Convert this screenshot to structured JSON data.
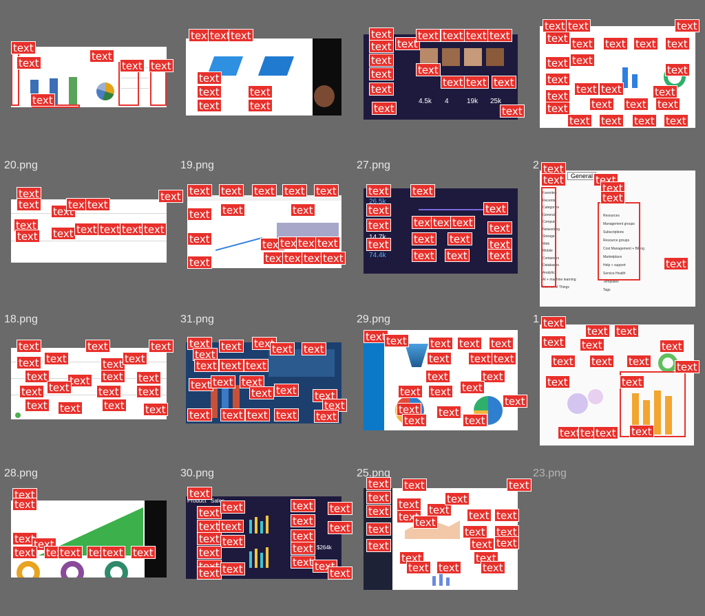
{
  "grid": {
    "background": "#6a6a6a",
    "tag_color": "#e8302b",
    "tag_text": "text"
  },
  "cells": [
    {
      "id": "c1",
      "label": ""
    },
    {
      "id": "c2",
      "label": ""
    },
    {
      "id": "c3",
      "label": ""
    },
    {
      "id": "c4",
      "label": ""
    },
    {
      "id": "c5",
      "label": "20.png"
    },
    {
      "id": "c6",
      "label": "19.png"
    },
    {
      "id": "c7",
      "label": "27.png"
    },
    {
      "id": "c8",
      "label": "2"
    },
    {
      "id": "c9",
      "label": "18.png"
    },
    {
      "id": "c10",
      "label": "31.png"
    },
    {
      "id": "c11",
      "label": "29.png"
    },
    {
      "id": "c12",
      "label": "1"
    },
    {
      "id": "c13",
      "label": "28.png"
    },
    {
      "id": "c14",
      "label": "30.png"
    },
    {
      "id": "c15",
      "label": "25.png"
    },
    {
      "id": "c16",
      "label": "23.png"
    }
  ],
  "values": {
    "c3": [
      "4.5k",
      "4",
      "19k",
      "25k"
    ],
    "c7": [
      "26.5k",
      "14.7k",
      "74.4k"
    ],
    "c8": {
      "tab": "General",
      "left": [
        "Favorites",
        "Recents",
        "Categories",
        "General",
        "Compute",
        "Networking",
        "Storage",
        "Web",
        "Mobile",
        "Containers",
        "Databases",
        "Analytics",
        "AI + machine learning",
        "Internet of Things"
      ],
      "right": [
        "Resources",
        "Management groups",
        "Subscriptions",
        "Resource groups",
        "Cost Management + Billing",
        "Marketplace",
        "Help + support",
        "Service Health",
        "Templates",
        "Tags"
      ]
    },
    "c14": [
      "Product",
      "Sales",
      "$264k"
    ]
  }
}
